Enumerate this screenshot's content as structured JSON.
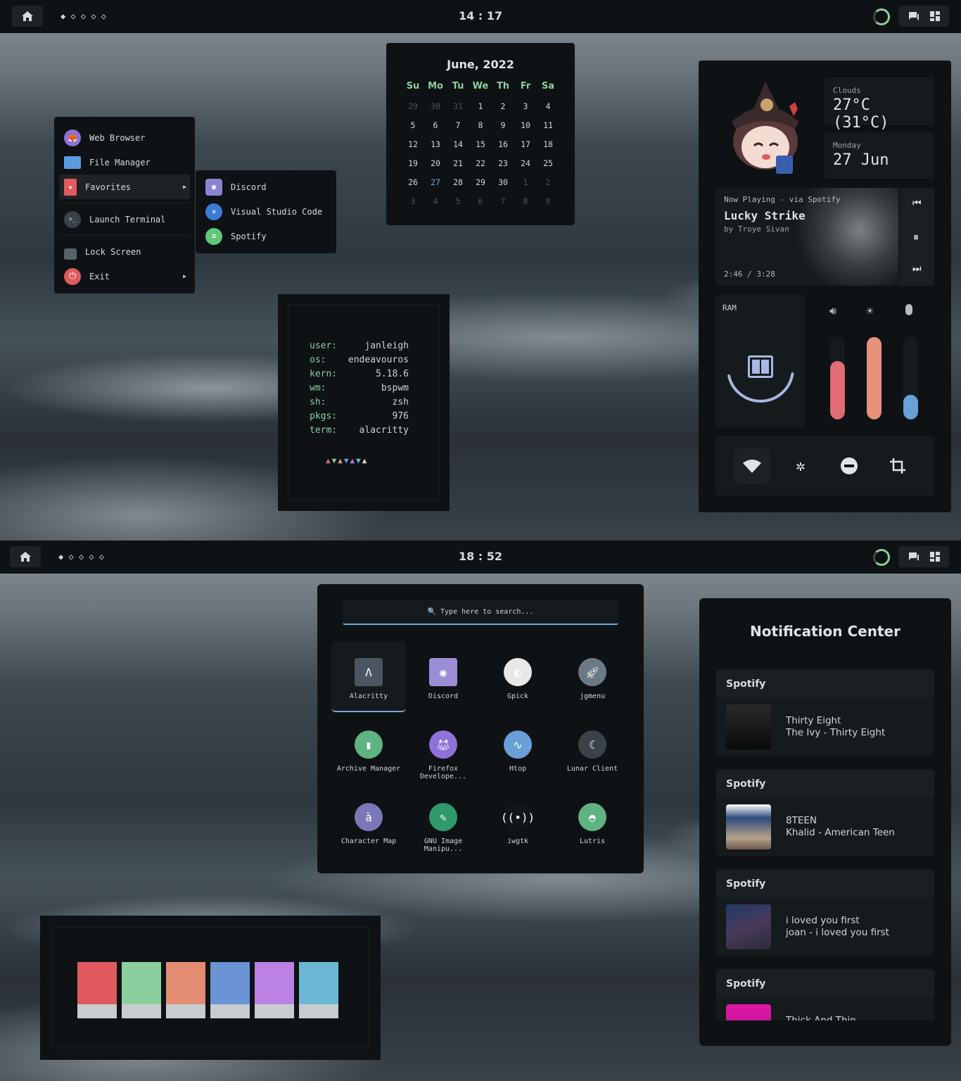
{
  "top_bar": {
    "clock": "14 : 17",
    "workspaces": "◆ ◇ ◇ ◇ ◇"
  },
  "bottom_bar": {
    "clock": "18 : 52",
    "workspaces": "◆ ◇ ◇ ◇ ◇"
  },
  "menu": {
    "items": [
      {
        "label": "Web Browser",
        "icon": "fox-icon"
      },
      {
        "label": "File Manager",
        "icon": "folder-icon"
      },
      {
        "label": "Favorites",
        "icon": "bookmark-star-icon"
      },
      {
        "label": "Launch Terminal",
        "icon": "terminal-icon"
      },
      {
        "label": "Lock Screen",
        "icon": "lock-icon"
      },
      {
        "label": "Exit",
        "icon": "power-icon"
      }
    ],
    "submenu": [
      {
        "label": "Discord",
        "icon": "discord-icon"
      },
      {
        "label": "Visual Studio Code",
        "icon": "vscode-icon"
      },
      {
        "label": "Spotify",
        "icon": "spotify-icon"
      }
    ]
  },
  "calendar": {
    "title": "June, 2022",
    "weekdays": [
      "Su",
      "Mo",
      "Tu",
      "We",
      "Th",
      "Fr",
      "Sa"
    ],
    "weeks": [
      [
        "29",
        "30",
        "31",
        "1",
        "2",
        "3",
        "4"
      ],
      [
        "5",
        "6",
        "7",
        "8",
        "9",
        "10",
        "11"
      ],
      [
        "12",
        "13",
        "14",
        "15",
        "16",
        "17",
        "18"
      ],
      [
        "19",
        "20",
        "21",
        "22",
        "23",
        "24",
        "25"
      ],
      [
        "26",
        "27",
        "28",
        "29",
        "30",
        "1",
        "2"
      ],
      [
        "3",
        "4",
        "5",
        "6",
        "7",
        "8",
        "9"
      ]
    ],
    "today": "27"
  },
  "fetch": {
    "rows": [
      {
        "key": "user:",
        "value": "janleigh"
      },
      {
        "key": "os:",
        "value": "endeavouros"
      },
      {
        "key": "kern:",
        "value": "5.18.6"
      },
      {
        "key": "wm:",
        "value": "bspwm"
      },
      {
        "key": "sh:",
        "value": "zsh"
      },
      {
        "key": "pkgs:",
        "value": "976"
      },
      {
        "key": "term:",
        "value": "alacritty"
      }
    ],
    "triangle_colors": [
      "#e06c75",
      "#8ccf9e",
      "#e8927c",
      "#6a9fd8",
      "#b77ee0",
      "#6ab8d4",
      "#d2d6d8"
    ]
  },
  "dashboard": {
    "weather": {
      "condition": "Clouds",
      "temp": "27°C (31°C)"
    },
    "date": {
      "day": "Monday",
      "date": "27 Jun"
    },
    "music": {
      "source": "Now Playing - via Spotify",
      "title": "Lucky Strike",
      "artist": "by Troye Sivan",
      "time": "2:46 / 3:28"
    },
    "ram": {
      "label": "RAM",
      "usage_fraction": 0.55
    },
    "sliders": [
      {
        "name": "volume",
        "icon": "volume-icon",
        "level": 0.7,
        "color": "#e06c75"
      },
      {
        "name": "brightness",
        "icon": "brightness-icon",
        "level": 0.99,
        "color": "#e8927c"
      },
      {
        "name": "microphone",
        "icon": "microphone-icon",
        "level": 0.3,
        "color": "#6a9fd8"
      }
    ],
    "toggles": [
      "wifi-icon",
      "bluetooth-icon",
      "do-not-disturb-icon",
      "screenshot-crop-icon"
    ]
  },
  "launcher": {
    "search_placeholder": "🔍 Type here to search...",
    "apps": [
      {
        "label": "Alacritty",
        "icon": "alacritty-icon",
        "color": "#4a5560",
        "selected": true
      },
      {
        "label": "Discord",
        "icon": "discord-icon",
        "color": "#9a8fd6"
      },
      {
        "label": "Gpick",
        "icon": "gpick-icon",
        "color": "#e8e8e8"
      },
      {
        "label": "jgmenu",
        "icon": "rocket-icon",
        "color": "#6c7a86"
      },
      {
        "label": "Archive Manager",
        "icon": "archive-icon",
        "color": "#5fb383"
      },
      {
        "label": "Firefox Develope...",
        "icon": "firefox-dev-icon",
        "color": "#8e72d8"
      },
      {
        "label": "Htop",
        "icon": "htop-icon",
        "color": "#6a9fd8"
      },
      {
        "label": "Lunar Client",
        "icon": "lunar-icon",
        "color": "#3a4148"
      },
      {
        "label": "Character Map",
        "icon": "charmap-icon",
        "color": "#7a78b8"
      },
      {
        "label": "GNU Image Manipu...",
        "icon": "gimp-icon",
        "color": "#2f9a6e"
      },
      {
        "label": "iwgtk",
        "icon": "wireless-icon",
        "color": "#11161a"
      },
      {
        "label": "Lutris",
        "icon": "lutris-icon",
        "color": "#5fb383"
      }
    ]
  },
  "notifications": {
    "title": "Notification Center",
    "items": [
      {
        "app": "Spotify",
        "title": "Thirty Eight",
        "body": "The Ivy - Thirty Eight"
      },
      {
        "app": "Spotify",
        "title": "8TEEN",
        "body": "Khalid - American Teen"
      },
      {
        "app": "Spotify",
        "title": "i loved you first",
        "body": "joan - i loved you first"
      },
      {
        "app": "Spotify",
        "title": "Thick And Thin",
        "body": ""
      }
    ]
  },
  "palette": {
    "colors": [
      "#e05a5f",
      "#8ccf9e",
      "#e38c72",
      "#6a94d4",
      "#bb82e3",
      "#6ab8d4"
    ]
  }
}
